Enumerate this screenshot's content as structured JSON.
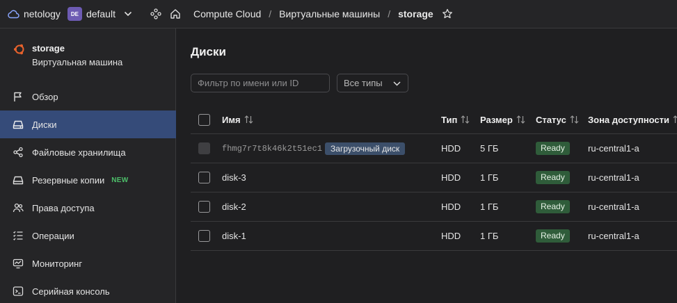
{
  "topbar": {
    "org": "netology",
    "folder_badge": "DE",
    "folder": "default",
    "breadcrumbs": [
      "Compute Cloud",
      "Виртуальные машины",
      "storage"
    ],
    "separator": "/"
  },
  "vm": {
    "name": "storage",
    "type": "Виртуальная машина"
  },
  "nav": [
    {
      "label": "Обзор",
      "icon": "flag-icon"
    },
    {
      "label": "Диски",
      "icon": "disk-icon",
      "active": true
    },
    {
      "label": "Файловые хранилища",
      "icon": "share-icon"
    },
    {
      "label": "Резервные копии",
      "icon": "backup-icon",
      "badge": "NEW"
    },
    {
      "label": "Права доступа",
      "icon": "users-icon"
    },
    {
      "label": "Операции",
      "icon": "list-check-icon"
    },
    {
      "label": "Мониторинг",
      "icon": "monitor-icon"
    },
    {
      "label": "Серийная консоль",
      "icon": "terminal-icon"
    }
  ],
  "main": {
    "title": "Диски",
    "filter_placeholder": "Фильтр по имени или ID",
    "type_select": "Все типы"
  },
  "table": {
    "columns": [
      "Имя",
      "Тип",
      "Размер",
      "Статус",
      "Зона доступности"
    ],
    "rows": [
      {
        "name": "fhmg7r7t8k46k2t51ec1",
        "badge": "Загрузочный диск",
        "type": "HDD",
        "size": "5 ГБ",
        "status": "Ready",
        "zone": "ru-central1-a",
        "disabled": true
      },
      {
        "name": "disk-3",
        "type": "HDD",
        "size": "1 ГБ",
        "status": "Ready",
        "zone": "ru-central1-a"
      },
      {
        "name": "disk-2",
        "type": "HDD",
        "size": "1 ГБ",
        "status": "Ready",
        "zone": "ru-central1-a"
      },
      {
        "name": "disk-1",
        "type": "HDD",
        "size": "1 ГБ",
        "status": "Ready",
        "zone": "ru-central1-a"
      }
    ]
  },
  "colors": {
    "accent_active": "#354b79",
    "ready_bg": "#2f5c3a",
    "new_badge": "#4dbf6a",
    "folder_badge": "#6d5bb3",
    "vm_logo": "#e8622c"
  }
}
